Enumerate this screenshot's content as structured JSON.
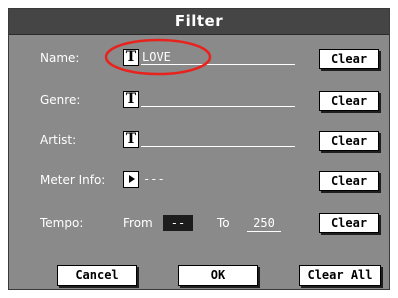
{
  "dialog": {
    "title": "Filter"
  },
  "fields": {
    "name": {
      "label": "Name:",
      "value": "LOVE",
      "type_button": "T",
      "clear_label": "Clear"
    },
    "genre": {
      "label": "Genre:",
      "value": "",
      "type_button": "T",
      "clear_label": "Clear"
    },
    "artist": {
      "label": "Artist:",
      "value": "",
      "type_button": "T",
      "clear_label": "Clear"
    },
    "meter": {
      "label": "Meter Info:",
      "value": "---",
      "clear_label": "Clear"
    },
    "tempo": {
      "label": "Tempo:",
      "from_label": "From",
      "from_value": "--",
      "to_label": "To",
      "to_value": "250",
      "clear_label": "Clear"
    }
  },
  "buttons": {
    "cancel": "Cancel",
    "ok": "OK",
    "clear_all": "Clear All"
  },
  "annotation": {
    "highlight_color": "#e8231e"
  },
  "colors": {
    "panel": "#8a8a8a",
    "titlebar": "#454545"
  },
  "icons": {
    "type_button": "text-T-icon",
    "meter_button": "play-arrow-icon"
  }
}
